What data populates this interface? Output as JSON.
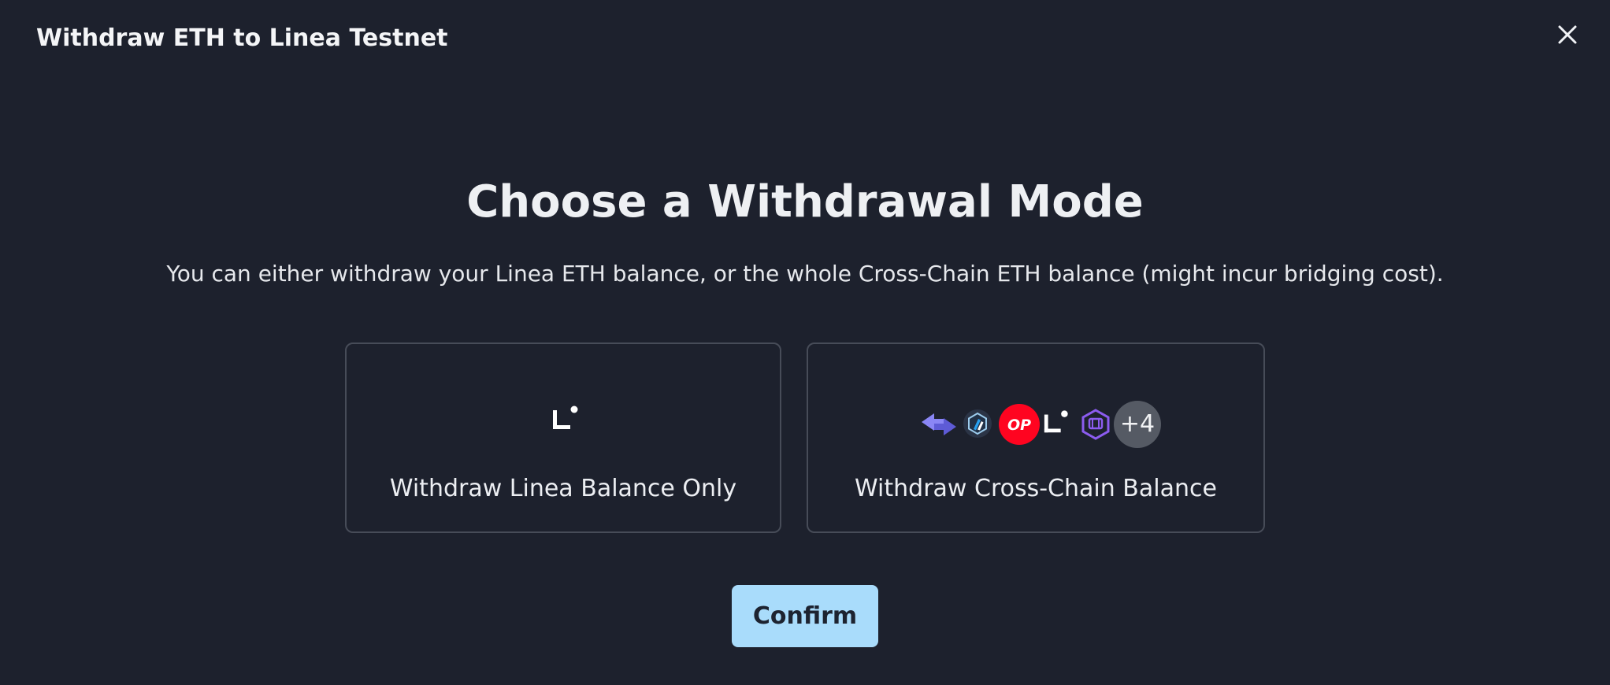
{
  "dialog": {
    "title": "Withdraw ETH to Linea Testnet",
    "heading": "Choose a Withdrawal Mode",
    "subtitle": "You can either withdraw your Linea ETH balance, or the whole Cross-Chain ETH balance (might incur bridging cost)."
  },
  "options": {
    "linea_only": {
      "label": "Withdraw Linea Balance Only",
      "icon": "linea-icon"
    },
    "cross_chain": {
      "label": "Withdraw Cross-Chain Balance",
      "icons": [
        "swap-arrows-icon",
        "arbitrum-icon",
        "optimism-icon",
        "linea-icon",
        "scroll-icon"
      ],
      "op_text": "OP",
      "more_count": "+4"
    }
  },
  "actions": {
    "confirm_label": "Confirm"
  },
  "colors": {
    "background": "#1d212d",
    "card_border": "#474c58",
    "confirm_bg": "#a9dcfb",
    "optimism_red": "#ff0420",
    "swap_purple": "#7b78f0",
    "scroll_purple": "#8c5cf0"
  }
}
